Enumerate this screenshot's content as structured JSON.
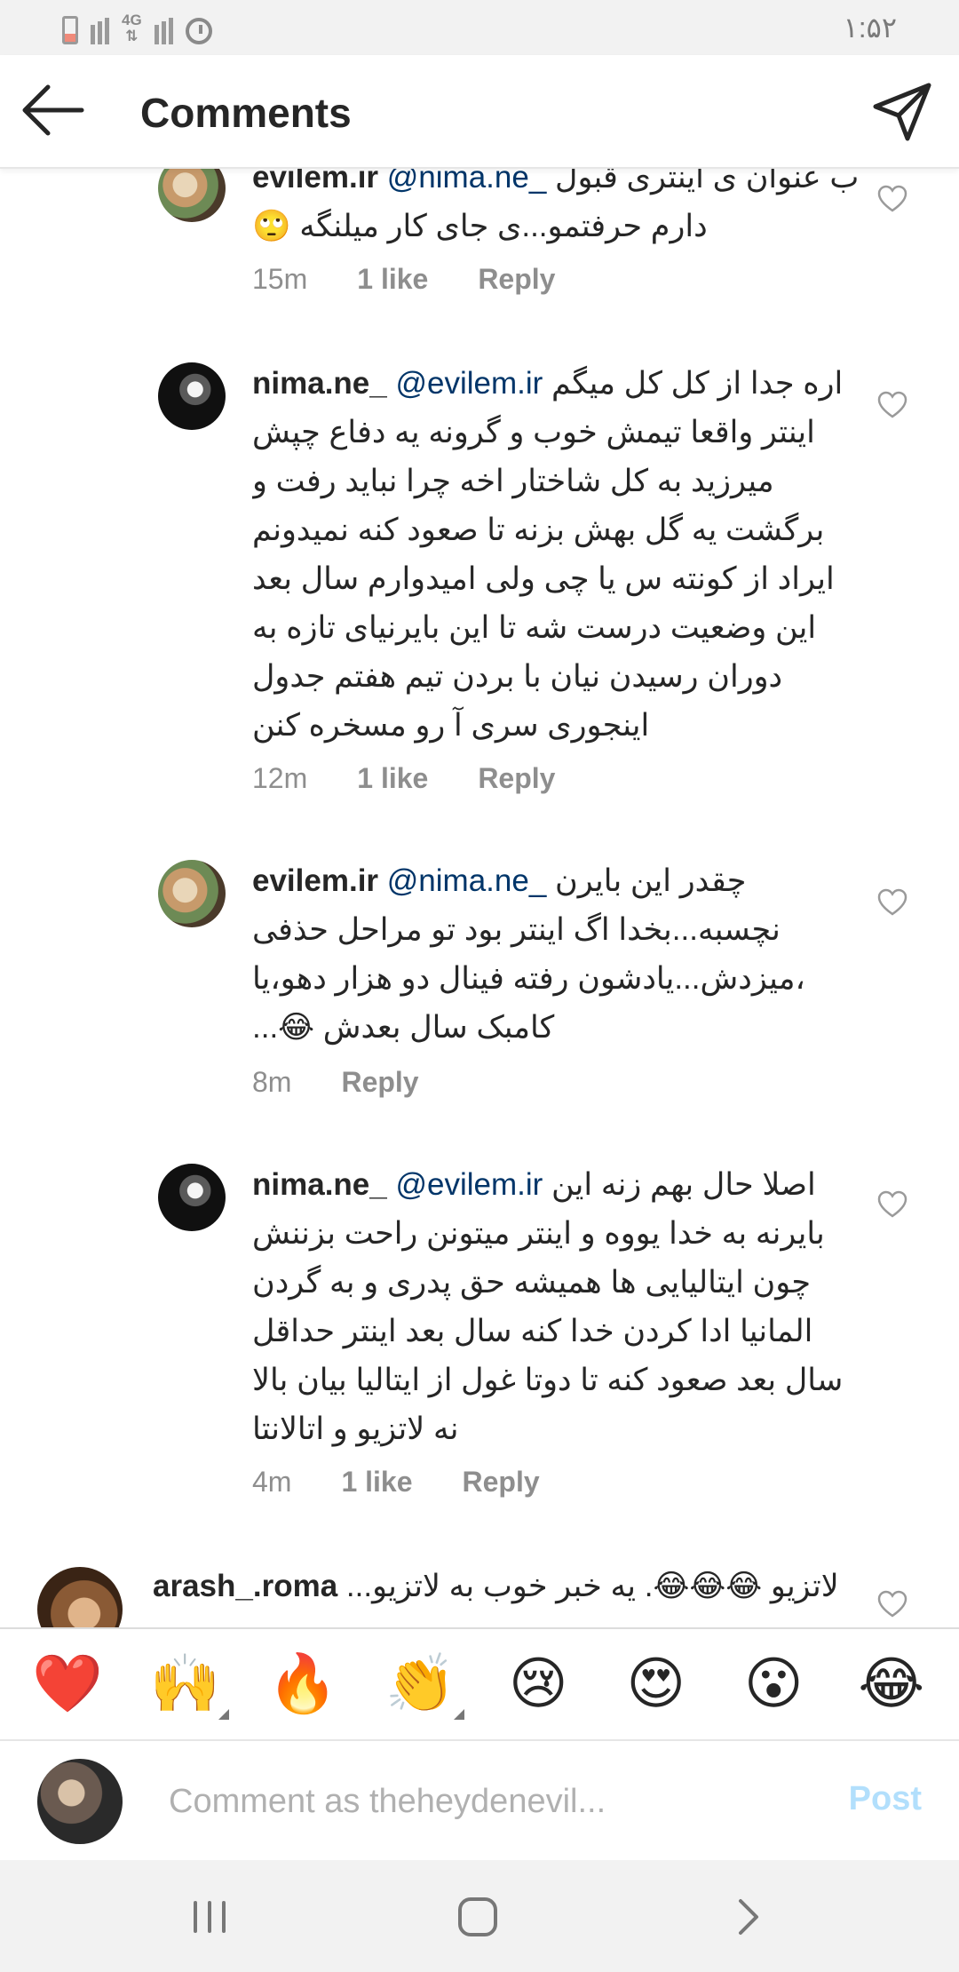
{
  "status_bar": {
    "network": "4G",
    "time": "۱:۵۲"
  },
  "header": {
    "title": "Comments"
  },
  "comments": [
    {
      "username": "evilem.ir",
      "mention": "@nima.ne_",
      "text": "ب عنوان ی اینتری قبول دارم حرفتمو...ی جای کار میلنگه 🙄",
      "time": "15m",
      "likes": "1 like",
      "reply": "Reply"
    },
    {
      "username": "nima.ne_",
      "mention": "@evilem.ir",
      "text": "اره جدا از کل کل میگم اینتر واقعا تیمش خوب و گرونه یه دفاع چپش میرزید به کل شاختار اخه چرا نباید رفت و برگشت یه گل بهش بزنه تا صعود کنه نمیدونم ایراد از کونته س یا چی ولی امیدوارم سال بعد این وضعیت درست شه تا این بایرنیای تازه به دوران رسیدن نیان با بردن تیم هفتم جدول اینجوری سری آ رو مسخره کنن",
      "time": "12m",
      "likes": "1 like",
      "reply": "Reply"
    },
    {
      "username": "evilem.ir",
      "mention": "@nima.ne_",
      "text": "چقدر این بایرن نچسبه...بخدا اگ اینتر بود تو مراحل حذفی ،میزدش...یادشون رفته فینال دو هزار دهو،یا کامبک سال بعدش 😂...",
      "time": "8m",
      "reply": "Reply"
    },
    {
      "username": "nima.ne_",
      "mention": "@evilem.ir",
      "text": "اصلا حال بهم زنه این بایرنه به خدا یووه و اینتر میتونن راحت بزننش چون ایتالیایی ها همیشه حق پدری و به گردن المانیا ادا کردن خدا کنه سال بعد اینتر حداقل سال بعد صعود کنه تا دوتا غول از ایتالیا بیان بالا نه لاتزیو و اتالانتا",
      "time": "4m",
      "likes": "1 like",
      "reply": "Reply"
    },
    {
      "username": "arash_.roma",
      "text": "لاتزیو 😂😂😂. یه خبر خوب به لاتزیو..."
    }
  ],
  "emoji_bar": [
    "❤️",
    "🙌",
    "🔥",
    "👏",
    "😢",
    "😍",
    "😮",
    "😂"
  ],
  "composer": {
    "placeholder": "Comment as theheydenevil...",
    "post_label": "Post"
  },
  "icons": {
    "back": "back-arrow-icon",
    "send": "direct-send-icon",
    "heart": "heart-outline-icon",
    "nav_recent": "recent-apps-icon",
    "nav_home": "home-icon",
    "nav_back": "back-chevron-icon"
  }
}
